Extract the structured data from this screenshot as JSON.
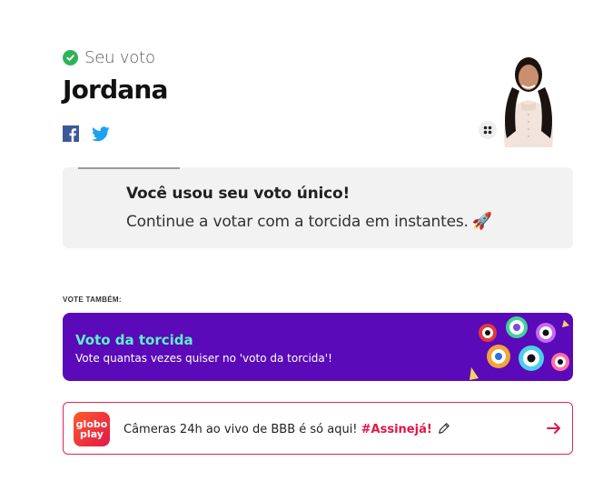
{
  "vote": {
    "status_label": "Seu voto",
    "candidate_name": "Jordana"
  },
  "info_card": {
    "title": "Você usou seu voto único!",
    "message": "Continue a votar com a torcida em instantes.",
    "emoji": "🚀"
  },
  "vote_also": {
    "label": "VOTE TAMBÉM:"
  },
  "fan_vote": {
    "title": "Voto da torcida",
    "subtitle": "Vote quantas vezes quiser no 'voto da torcida'!"
  },
  "promo": {
    "logo_line1": "globo",
    "logo_line2": "play",
    "text": "Câmeras 24h ao vivo de BBB é só aqui! ",
    "cta": "#Assinejá!"
  },
  "colors": {
    "check": "#2fb35a",
    "facebook": "#3b5998",
    "twitter": "#1da1f2",
    "banner": "#5a0ab8",
    "banner_title": "#5ef0c9",
    "promo_accent": "#e0174a"
  },
  "icons": [
    "check-icon",
    "facebook-icon",
    "twitter-icon",
    "grid-icon",
    "rocket-icon",
    "pencil-icon",
    "arrow-right-icon"
  ]
}
